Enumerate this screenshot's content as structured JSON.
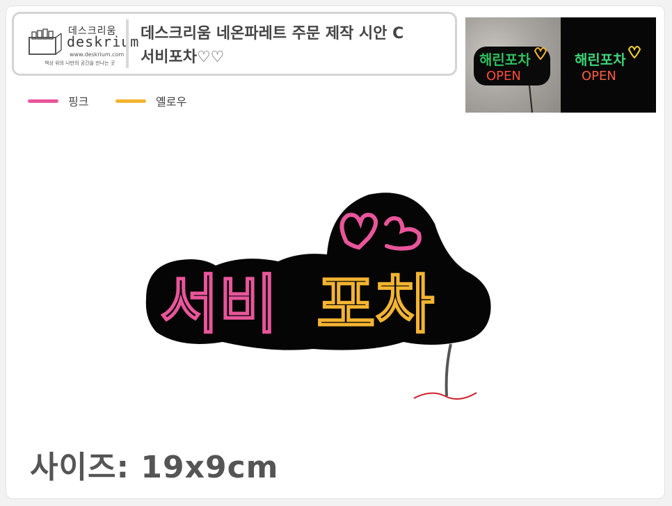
{
  "header": {
    "logo_kr": "데스크리움",
    "logo_en": "deskrium",
    "logo_url": "www.deskrium.com",
    "logo_tagline": "책상 위의 나만의 공간을 만나는 곳",
    "title_line1": "데스크리움 네온파레트 주문 제작 시안 C",
    "title_line2": "서비포차♡♡"
  },
  "legend": [
    {
      "label": "핑크",
      "color": "#e8559a"
    },
    {
      "label": "옐로우",
      "color": "#f3b431"
    }
  ],
  "preview": {
    "wall_line1": "해린포차",
    "wall_line2": "OPEN",
    "dark_line1": "해린포차",
    "dark_line2": "OPEN"
  },
  "design": {
    "pink_text": "서비",
    "yellow_text": "포차",
    "pink_color": "#e8559a",
    "yellow_color": "#f3b431",
    "backing_color": "#050505"
  },
  "size_label": "사이즈: 19x9cm"
}
